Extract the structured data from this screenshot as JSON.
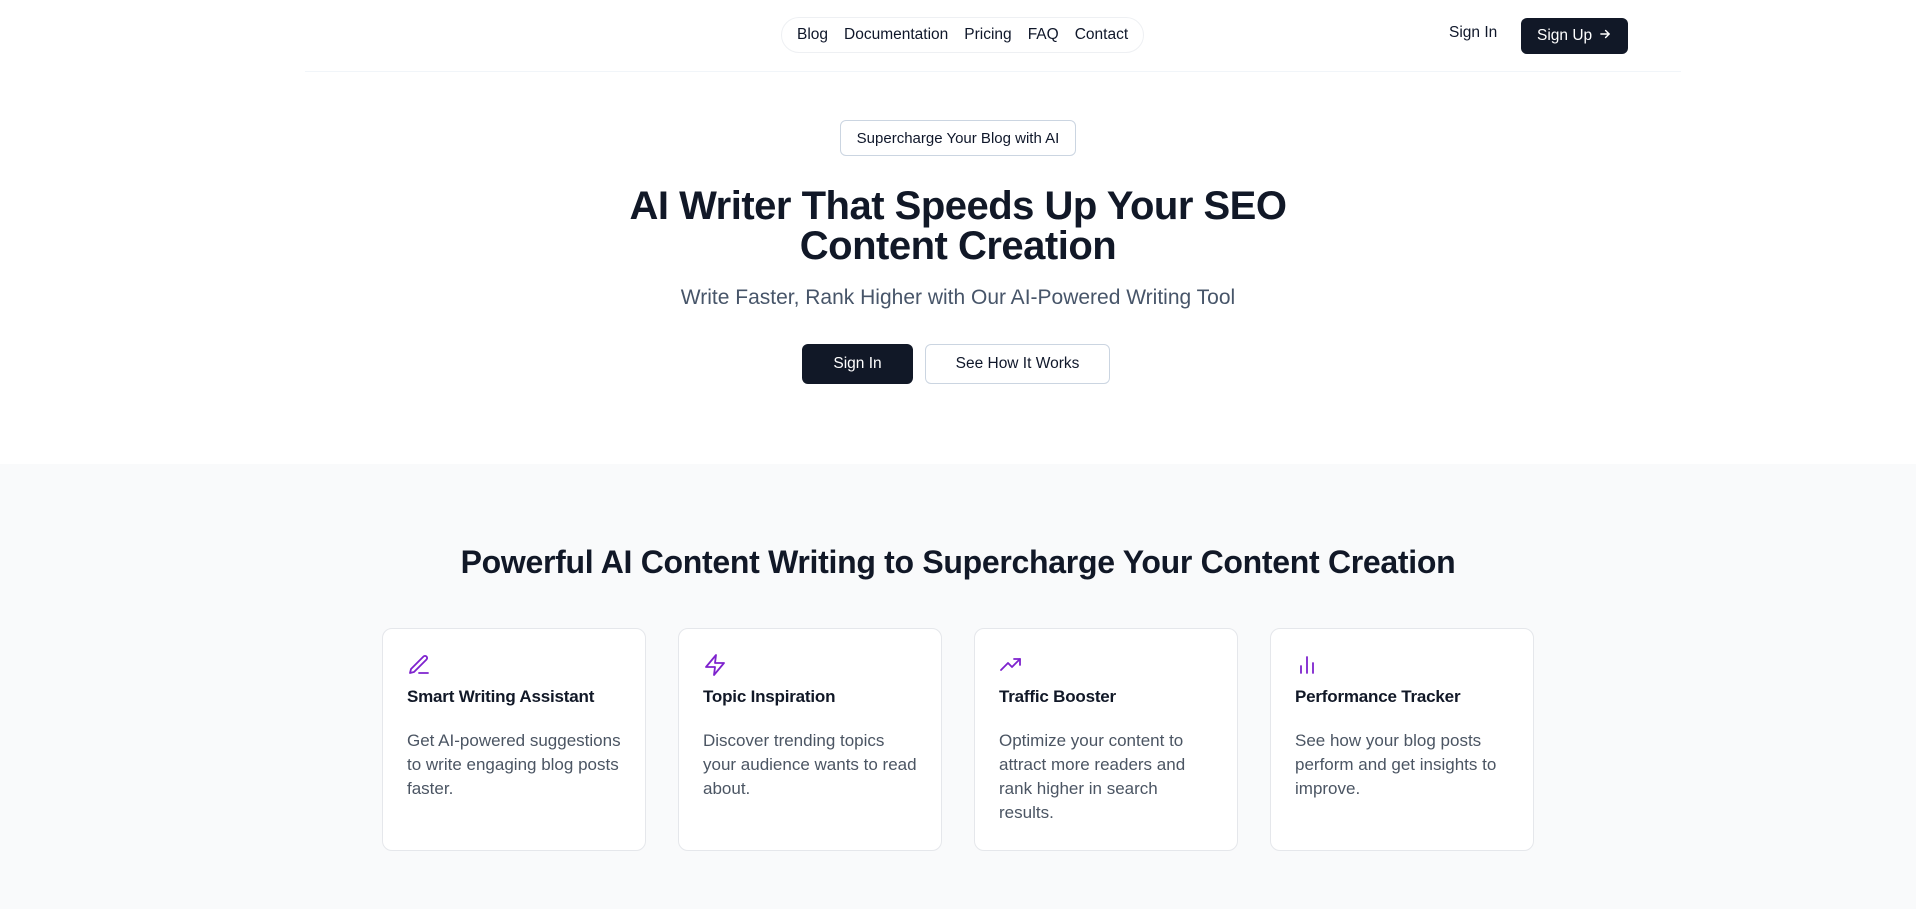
{
  "nav": {
    "links": [
      "Blog",
      "Documentation",
      "Pricing",
      "FAQ",
      "Contact"
    ],
    "signin_label": "Sign In",
    "signup_label": "Sign Up"
  },
  "hero": {
    "badge": "Supercharge Your Blog with AI",
    "title": "AI Writer That Speeds Up Your SEO Content Creation",
    "subtitle": "Write Faster, Rank Higher with Our AI-Powered Writing Tool",
    "primary_button": "Sign In",
    "secondary_button": "See How It Works"
  },
  "features": {
    "title": "Powerful AI Content Writing to Supercharge Your Content Creation",
    "accent_color": "#7e22ce",
    "cards": [
      {
        "icon": "pencil-icon",
        "title": "Smart Writing Assistant",
        "description": "Get AI-powered suggestions to write engaging blog posts faster."
      },
      {
        "icon": "lightning-icon",
        "title": "Topic Inspiration",
        "description": "Discover trending topics your audience wants to read about."
      },
      {
        "icon": "trending-up-icon",
        "title": "Traffic Booster",
        "description": "Optimize your content to attract more readers and rank higher in search results."
      },
      {
        "icon": "bar-chart-icon",
        "title": "Performance Tracker",
        "description": "See how your blog posts perform and get insights to improve."
      }
    ]
  }
}
